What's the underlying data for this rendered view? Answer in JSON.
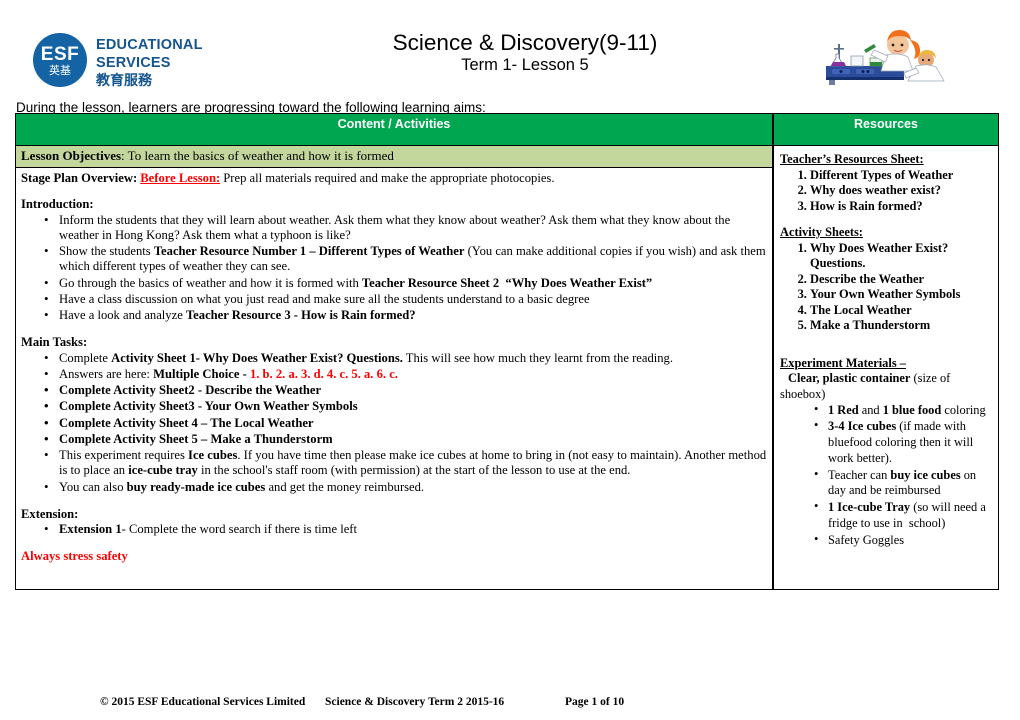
{
  "header": {
    "logo": {
      "mark_text": "ESF",
      "mark_text_cn": "英基",
      "line1": "EDUCATIONAL",
      "line2": "SERVICES",
      "line3": "教育服務",
      "brand_color": "#14558F",
      "mark_color": "#1464A5"
    },
    "title": "Science & Discovery(9-11)",
    "subtitle": "Term 1- Lesson 5",
    "clipart_alt": "children-science-experiment-clipart"
  },
  "aims_line": "During the lesson, learners are progressing toward the following learning aims:",
  "table": {
    "header_bg": "#00A650",
    "objectives_bg": "#C3D69B",
    "columns": [
      {
        "label": "Content / Activities"
      },
      {
        "label": "Resources"
      }
    ],
    "objectives": {
      "label": "Lesson Objectives",
      "text": ":  To learn the basics of weather and how it is formed"
    },
    "content": {
      "stage_plan_label": "Stage Plan Overview",
      "stage_plan_sep": ":  ",
      "before_lesson_label": "Before Lesson:",
      "stage_plan_text": " Prep all materials required and make the appropriate photocopies.",
      "introduction_heading": "Introduction:",
      "introduction_items": [
        "Inform the students that they will learn about weather. Ask them what they know about weather? Ask them what they know about the weather in Hong Kong? Ask them what a typhoon is like?",
        "Show the students Teacher Resource Number 1 – Different Types of Weather (You can make additional copies if you wish) and ask them which different types of weather they can see.",
        "Go through the basics of weather and how it is formed with Teacher Resource Sheet 2  “Why Does Weather Exist”",
        "Have a class discussion on what you just read and make sure all the students understand to a basic degree",
        "Have a look and analyze Teacher Resource 3 - How is Rain formed?"
      ],
      "main_tasks_heading": "Main Tasks:",
      "main_tasks_items": [
        "Complete Activity Sheet 1- Why Does Weather Exist? Questions. This will see how much they learnt from the reading.",
        "Answers are here: Multiple Choice - 1. b. 2. a. 3. d. 4. c. 5. a. 6. c.",
        "Complete Activity Sheet2 - Describe the Weather",
        "Complete Activity Sheet3 - Your Own Weather Symbols",
        "Complete Activity Sheet 4 – The Local Weather",
        "Complete Activity Sheet 5 – Make a Thunderstorm",
        "This experiment requires Ice cubes. If you have time then please make ice cubes at home to bring in (not easy to maintain). Another method is to place an ice-cube tray in the school's staff room (with permission) at the start of the lesson to use at the end.",
        "You can also buy ready-made ice cubes and get the money reimbursed."
      ],
      "extension_heading": "Extension:",
      "extension_items": [
        "Extension 1- Complete the word search if there is time left"
      ],
      "safety_note": "Always stress safety",
      "safety_color": "#FF0000"
    },
    "resources": {
      "teacher_sheet_heading": "Teacher’s Resources Sheet:",
      "teacher_sheet_items": [
        "Different Types of Weather",
        "Why does weather exist?",
        "How is Rain formed?"
      ],
      "activity_sheets_heading": "Activity Sheets:",
      "activity_sheets_items": [
        "Why Does Weather Exist? Questions.",
        "Describe the Weather",
        "Your Own Weather Symbols",
        "The Local Weather",
        "Make a Thunderstorm"
      ],
      "experiment_heading": "Experiment Materials –",
      "experiment_lead_bold": "Clear, plastic container",
      "experiment_lead_rest": " (size of shoebox)",
      "experiment_items": [
        "1 Red and 1 blue food coloring",
        "3-4 Ice cubes (if made with bluefood coloring then it will work better).",
        "Teacher can buy ice cubes on day and be reimbursed",
        "1 Ice-cube Tray (so will need a fridge to use in  school)",
        "Safety Goggles"
      ]
    }
  },
  "footer": {
    "copyright": "© 2015 ESF Educational Services Limited",
    "doc_title": "Science & Discovery Term 2 2015-16",
    "page": "Page 1 of 10"
  }
}
